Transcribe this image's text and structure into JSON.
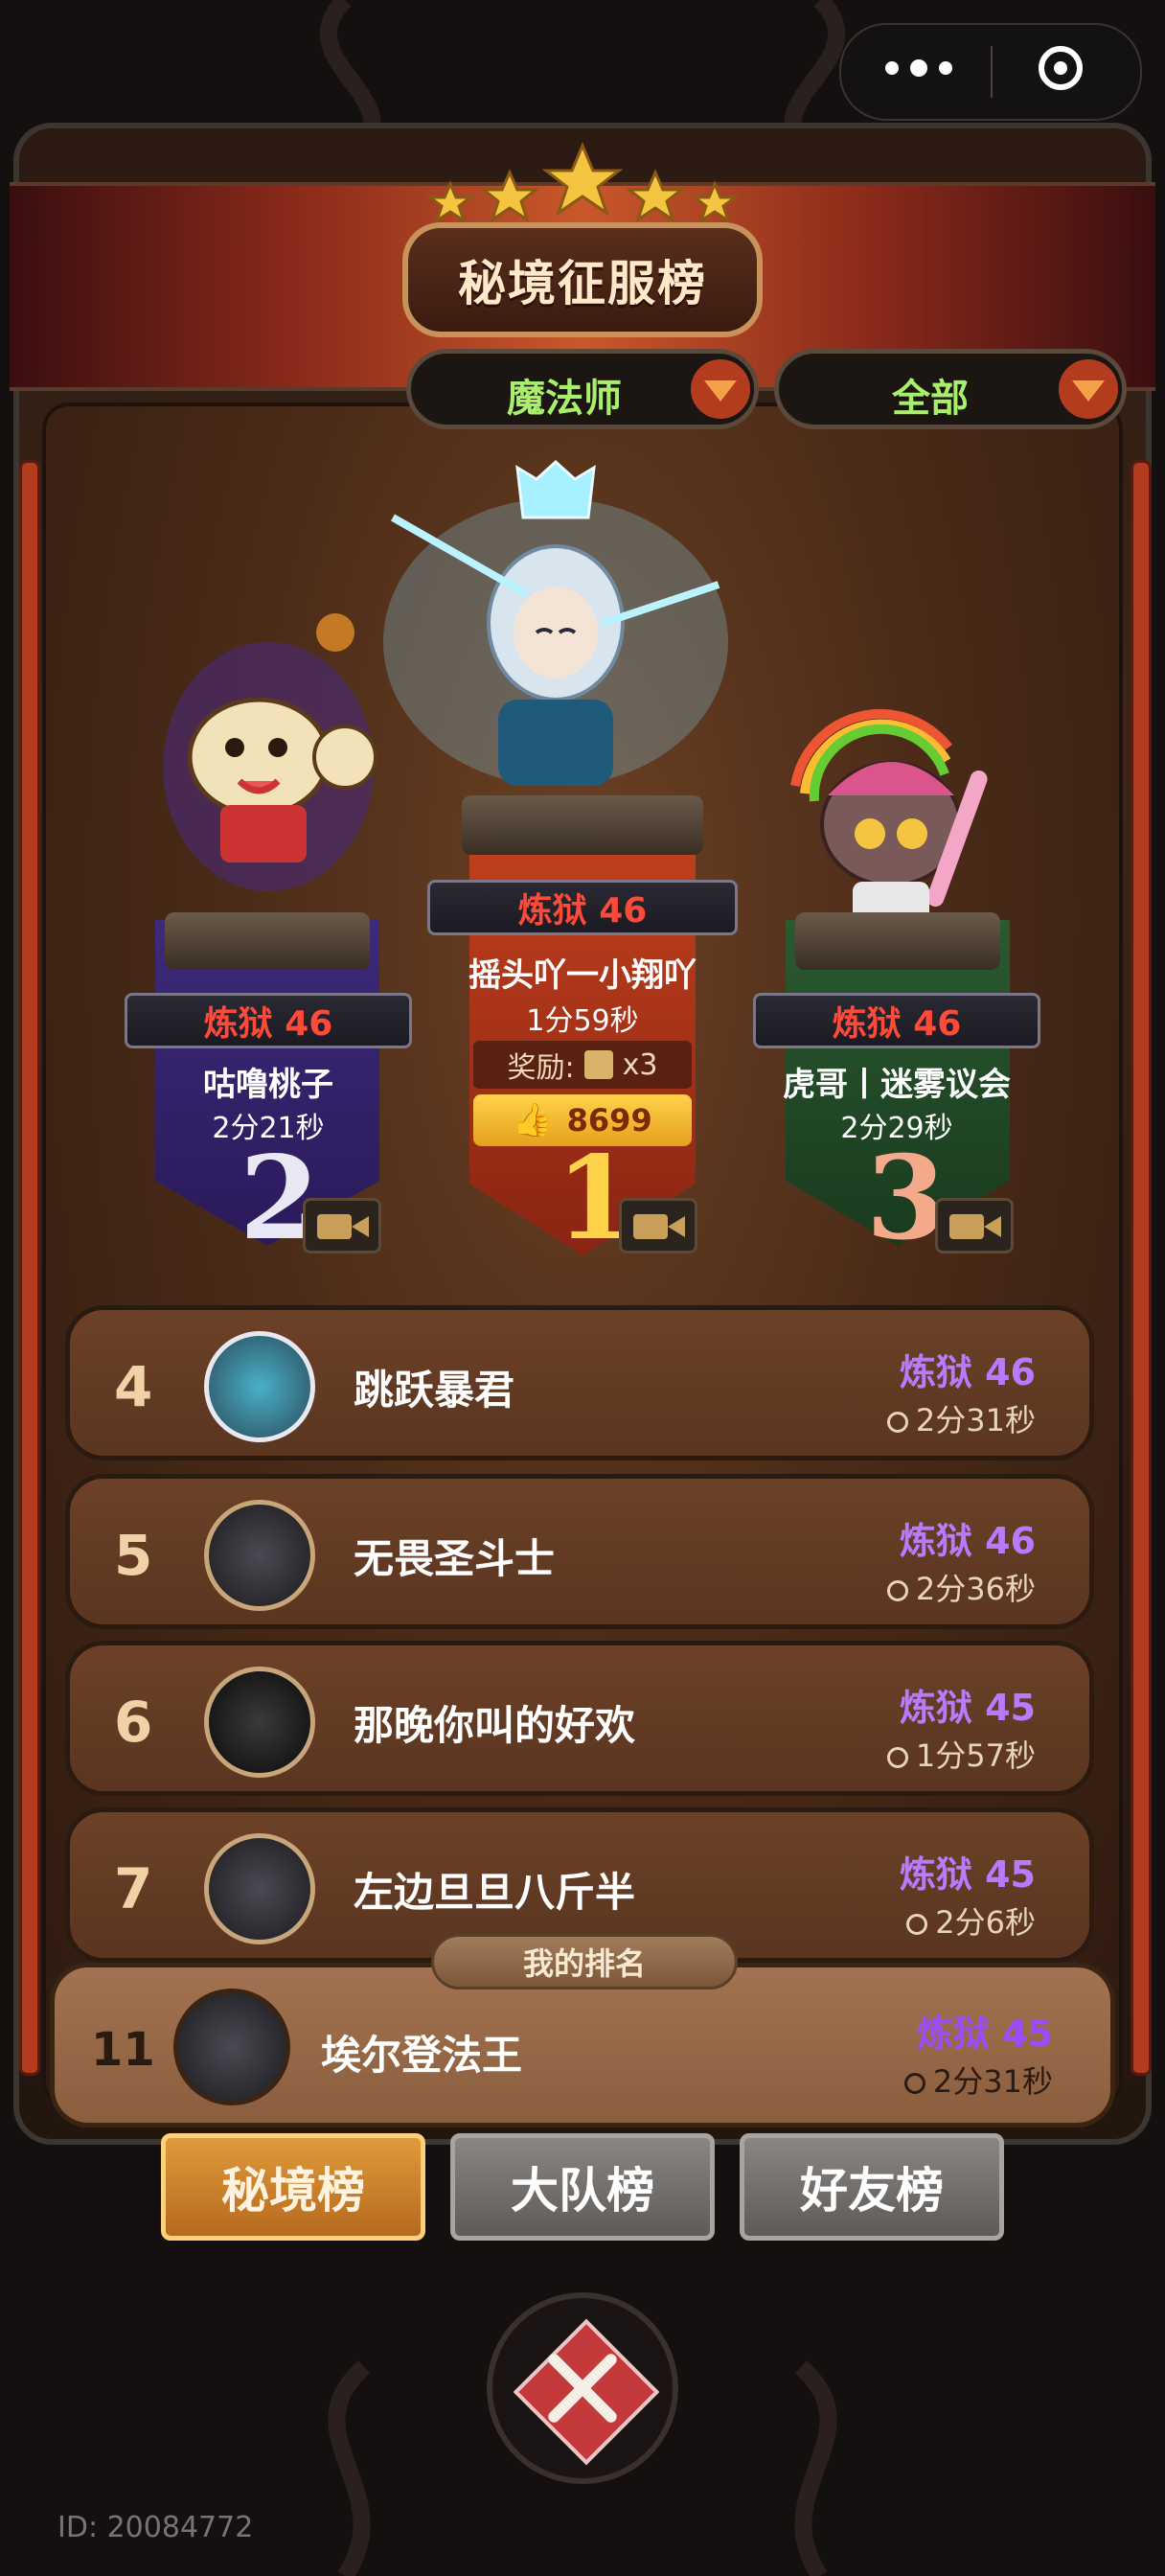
{
  "header": {
    "title": "秘境征服榜"
  },
  "filters": {
    "class": {
      "label": "魔法师"
    },
    "scope": {
      "label": "全部"
    }
  },
  "podium": [
    {
      "rank": "1",
      "level": "炼狱 46",
      "name": "摇头吖一小翔吖",
      "time": "1分59秒",
      "reward_label": "奖励:",
      "reward_count": "x3",
      "likes": "8699"
    },
    {
      "rank": "2",
      "level": "炼狱 46",
      "name": "咕噜桃子",
      "time": "2分21秒"
    },
    {
      "rank": "3",
      "level": "炼狱 46",
      "name": "虎哥丨迷雾议会",
      "time": "2分29秒"
    }
  ],
  "rows": [
    {
      "rank": "4",
      "name": "跳跃暴君",
      "level": "炼狱 46",
      "time": "2分31秒"
    },
    {
      "rank": "5",
      "name": "无畏圣斗士",
      "level": "炼狱 46",
      "time": "2分36秒"
    },
    {
      "rank": "6",
      "name": "那晚你叫的好欢",
      "level": "炼狱 45",
      "time": "1分57秒"
    },
    {
      "rank": "7",
      "name": "左边旦旦八斤半",
      "level": "炼狱 45",
      "time": "2分6秒"
    }
  ],
  "my_rank": {
    "tag": "我的排名",
    "rank": "11",
    "name": "埃尔登法王",
    "level": "炼狱 45",
    "time": "2分31秒"
  },
  "tabs": [
    {
      "label": "秘境榜",
      "active": true
    },
    {
      "label": "大队榜",
      "active": false
    },
    {
      "label": "好友榜",
      "active": false
    }
  ],
  "footer": {
    "id_text": "ID: 20084772"
  },
  "colors": {
    "level_red": "#ff4a3a",
    "level_purple": "#b87bff",
    "filter_green": "#a9f06a",
    "accent_orange": "#e09a3a"
  }
}
